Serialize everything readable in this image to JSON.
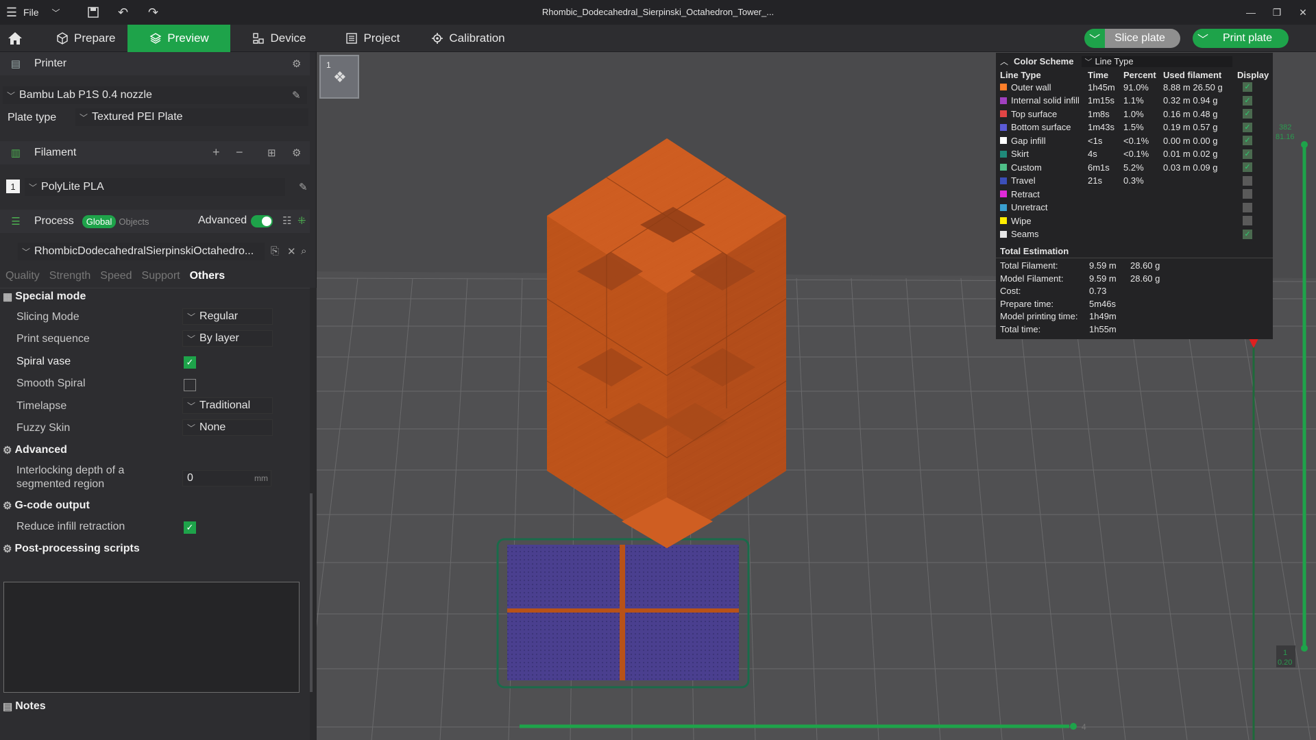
{
  "titlebar": {
    "file_label": "File",
    "title": "Rhombic_Dodecahedral_Sierpinski_Octahedron_Tower_..."
  },
  "nav": {
    "tabs": [
      {
        "label": "Prepare",
        "icon": "cube-icon"
      },
      {
        "label": "Preview",
        "icon": "layers-icon",
        "active": true
      },
      {
        "label": "Device",
        "icon": "device-icon"
      },
      {
        "label": "Project",
        "icon": "project-icon"
      },
      {
        "label": "Calibration",
        "icon": "calibration-icon"
      }
    ],
    "slice_label": "Slice plate",
    "print_label": "Print plate"
  },
  "printer": {
    "section_label": "Printer",
    "name": "Bambu Lab P1S 0.4 nozzle",
    "plate_type_label": "Plate type",
    "plate_type_value": "Textured PEI Plate"
  },
  "filament": {
    "section_label": "Filament",
    "slot": "1",
    "name": "PolyLite PLA"
  },
  "process": {
    "section_label": "Process",
    "global_label": "Global",
    "objects_label": "Objects",
    "advanced_label": "Advanced",
    "preset_name": "RhombicDodecahedralSierpinskiOctahedro...",
    "tabs": [
      "Quality",
      "Strength",
      "Speed",
      "Support",
      "Others"
    ],
    "active_tab": "Others"
  },
  "options": {
    "special_mode": "Special mode",
    "slicing_mode_label": "Slicing Mode",
    "slicing_mode_value": "Regular",
    "print_sequence_label": "Print sequence",
    "print_sequence_value": "By layer",
    "spiral_vase_label": "Spiral vase",
    "spiral_vase": true,
    "smooth_spiral_label": "Smooth Spiral",
    "smooth_spiral": false,
    "timelapse_label": "Timelapse",
    "timelapse_value": "Traditional",
    "fuzzy_skin_label": "Fuzzy Skin",
    "fuzzy_skin_value": "None",
    "advanced_group": "Advanced",
    "interlocking_label_1": "Interlocking depth of a",
    "interlocking_label_2": "segmented region",
    "interlocking_value": "0",
    "interlocking_unit": "mm",
    "gcode_group": "G-code output",
    "reduce_infill_label": "Reduce infill retraction",
    "reduce_infill": true,
    "post_processing_group": "Post-processing scripts",
    "notes_group": "Notes"
  },
  "viewport": {
    "plate_number": "1",
    "layer_top_1": "382",
    "layer_top_2": "81.16",
    "layer_bottom_1": "1",
    "layer_bottom_2": "0.20",
    "horizontal_slider_value": "4"
  },
  "legend": {
    "color_scheme_label": "Color Scheme",
    "scheme_value": "Line Type",
    "headers": [
      "Line Type",
      "Time",
      "Percent",
      "Used filament",
      "Display"
    ],
    "rows": [
      {
        "name": "Outer wall",
        "color": "#ff7f2a",
        "time": "1h45m",
        "percent": "91.0%",
        "used": "8.88 m  26.50 g",
        "display": true
      },
      {
        "name": "Internal solid infill",
        "color": "#a040c0",
        "time": "1m15s",
        "percent": "1.1%",
        "used": "0.32 m  0.94 g",
        "display": true
      },
      {
        "name": "Top surface",
        "color": "#e24545",
        "time": "1m8s",
        "percent": "1.0%",
        "used": "0.16 m  0.48 g",
        "display": true
      },
      {
        "name": "Bottom surface",
        "color": "#5b5bd6",
        "time": "1m43s",
        "percent": "1.5%",
        "used": "0.19 m  0.57 g",
        "display": true
      },
      {
        "name": "Gap infill",
        "color": "#ffffff",
        "time": "<1s",
        "percent": "<0.1%",
        "used": "0.00 m  0.00 g",
        "display": true
      },
      {
        "name": "Skirt",
        "color": "#1f8a7a",
        "time": "4s",
        "percent": "<0.1%",
        "used": "0.01 m  0.02 g",
        "display": true
      },
      {
        "name": "Custom",
        "color": "#4fbf88",
        "time": "6m1s",
        "percent": "5.2%",
        "used": "0.03 m  0.09 g",
        "display": true
      },
      {
        "name": "Travel",
        "color": "#3b4fb8",
        "time": "21s",
        "percent": "0.3%",
        "used": "",
        "display": false
      },
      {
        "name": "Retract",
        "color": "#e02ad8",
        "time": "",
        "percent": "",
        "used": "",
        "display": false
      },
      {
        "name": "Unretract",
        "color": "#3aa0d0",
        "time": "",
        "percent": "",
        "used": "",
        "display": false
      },
      {
        "name": "Wipe",
        "color": "#ffee00",
        "time": "",
        "percent": "",
        "used": "",
        "display": false
      },
      {
        "name": "Seams",
        "color": "#e6e6e6",
        "time": "",
        "percent": "",
        "used": "",
        "display": true
      }
    ],
    "total_title": "Total Estimation",
    "totals": [
      {
        "k": "Total Filament:",
        "v1": "9.59 m",
        "v2": "28.60 g"
      },
      {
        "k": "Model Filament:",
        "v1": "9.59 m",
        "v2": "28.60 g"
      },
      {
        "k": "Cost:",
        "v1": "0.73",
        "v2": ""
      },
      {
        "k": "Prepare time:",
        "v1": "5m46s",
        "v2": ""
      },
      {
        "k": "Model printing time:",
        "v1": "1h49m",
        "v2": ""
      },
      {
        "k": "Total time:",
        "v1": "1h55m",
        "v2": ""
      }
    ]
  },
  "colors": {
    "accent": "#1ea34a",
    "model": "#c8581c",
    "bottom_surface": "#3d3d8a"
  }
}
